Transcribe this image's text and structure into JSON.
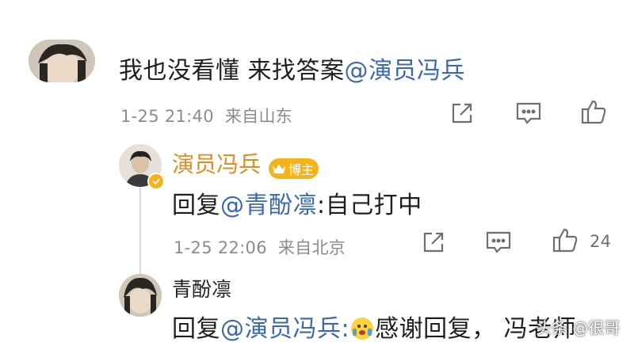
{
  "comment": {
    "text_prefix": "我也没看懂 来找答案",
    "mention": "@演员冯兵",
    "time": "1-25 21:40",
    "source": "来自山东"
  },
  "reply1": {
    "username": "演员冯兵",
    "badge": "博主",
    "text_prefix": "回复",
    "mention": "@青酚凛",
    "text_suffix": ":自己打中",
    "time": "1-25 22:06",
    "source": "来自北京",
    "like_count": "24"
  },
  "reply2": {
    "username": "青酚凛",
    "text_prefix": "回复",
    "mention": "@演员冯兵:",
    "text_suffix": "感谢回复， 冯老师"
  },
  "watermark": "头条 @很哥",
  "colors": {
    "author_name": "#e8891d",
    "mention": "#3a67b8",
    "badge": "#f7b21a"
  },
  "icons": [
    "share-icon",
    "comment-icon",
    "like-icon",
    "verified-icon",
    "crown-icon",
    "emoji-icon"
  ]
}
